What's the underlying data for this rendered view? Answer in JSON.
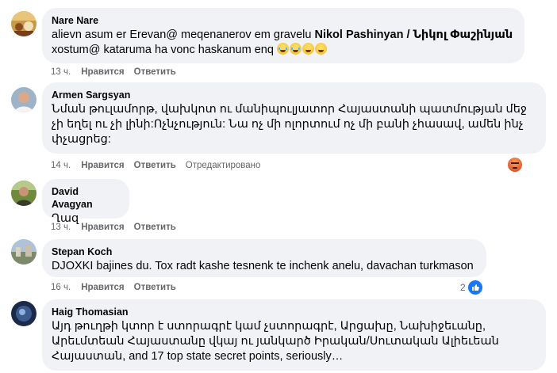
{
  "comments": [
    {
      "author": "Nare Nare",
      "text_pre": "alievn asum er Erevan@ meqenanerov em gravelu ",
      "mention": "Nikol Pashinyan / Նիկոլ Փաշինյան",
      "text_post": "xostum@ kataruma ha vonc haskanum enq ",
      "emojis": [
        "cold-sweat-emoji",
        "cold-sweat-emoji",
        "sad-emoji",
        "sad-emoji"
      ],
      "time": "13 ч.",
      "like_label": "Нравится",
      "reply_label": "Ответить"
    },
    {
      "author": "Armen Sargsyan",
      "text": "Նման թուլամորթ, վախկոտ ու մանիպուլյատոր Հայաստանի պատմության մեջ չի եղել ու չի լինի:Ոչնչություն: Նա ոչ մի ոլորտում ոչ մի բանի չհասավ, ամեն ինչ փչացրեց:",
      "time": "14 ч.",
      "like_label": "Нравится",
      "reply_label": "Ответить",
      "edited_label": "Отредактировано",
      "reaction": "angry-icon"
    },
    {
      "author": "David Avagyan",
      "text": "Ղազ",
      "time": "13 ч.",
      "like_label": "Нравится",
      "reply_label": "Ответить"
    },
    {
      "author": "Stepan Koch",
      "text": "DJOXKI bajines du. Tox radt kashe tesnenk te inchenk anelu, davachan turkmason",
      "time": "16 ч.",
      "like_label": "Нравится",
      "reply_label": "Ответить",
      "reaction": "like-icon",
      "reaction_count": "2"
    },
    {
      "author": "Haig Thomasian",
      "text": "Այդ թուղթի կտոր է ստորագրէ կամ չստորագրէ, Արցախը, Նախիջեւանը, Արեւմտեան Հայաստանը վկայ ու յանկարծ Իրական/Սուտական Ալիեւեան Հայաստան, and 17 top state secret points, seriously…"
    }
  ]
}
